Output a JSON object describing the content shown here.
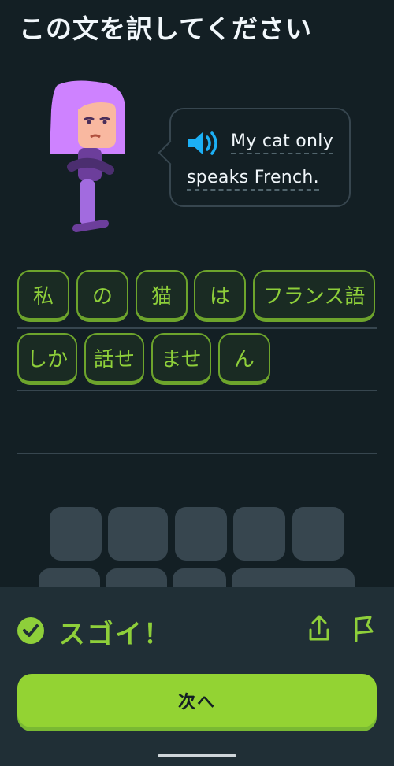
{
  "header": {
    "title": "この文を訳してください"
  },
  "prompt": {
    "line1": "My cat only",
    "line2": "speaks French.",
    "speaker_icon": "speaker-icon"
  },
  "answer_tiles": [
    "私",
    "の",
    "猫",
    "は",
    "フランス語",
    "しか",
    "話せ",
    "ませ",
    "ん"
  ],
  "feedback": {
    "message": "スゴイ！",
    "check_icon": "check-circle-icon",
    "share_icon": "share-icon",
    "flag_icon": "flag-icon"
  },
  "footer": {
    "next_label": "次へ"
  },
  "colors": {
    "background": "#131f24",
    "accent_green": "#8ecf3a",
    "button_green": "#93d333",
    "panel": "#202f36"
  }
}
